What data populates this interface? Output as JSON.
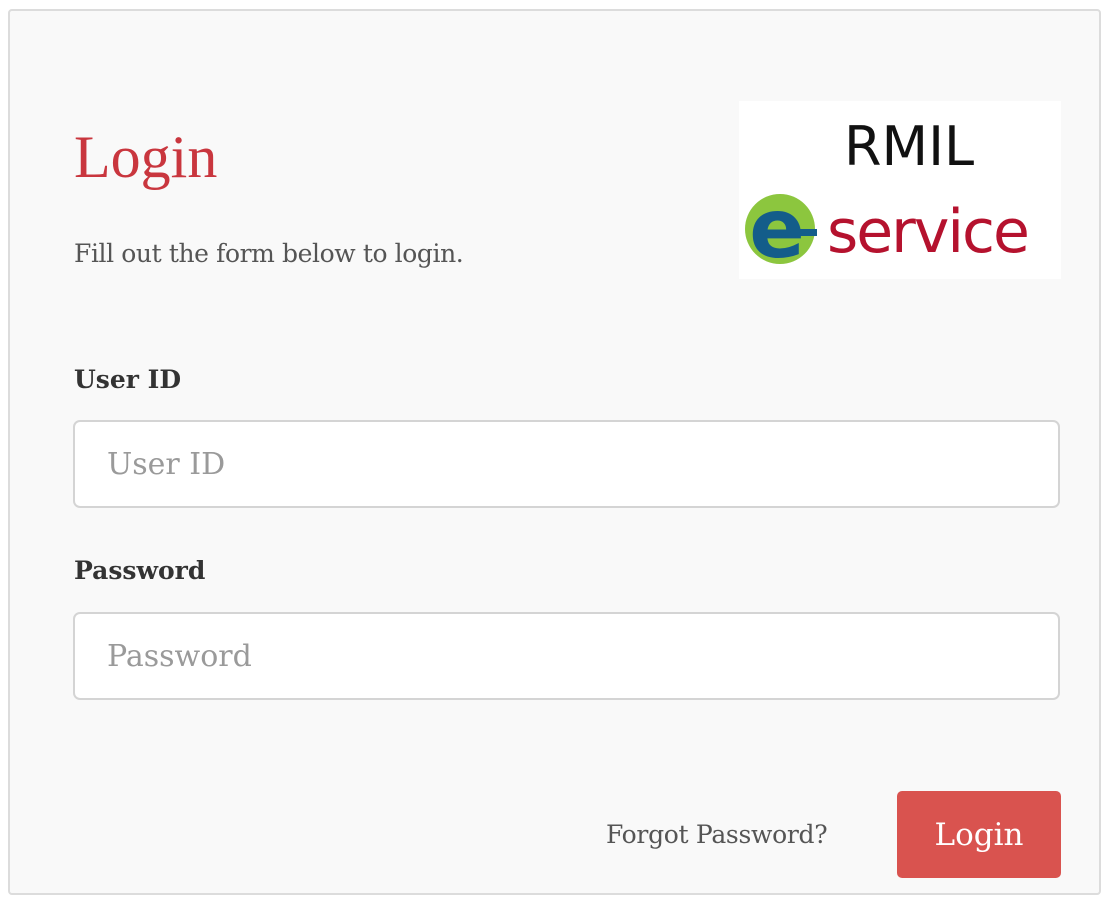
{
  "login_panel": {
    "title": "Login",
    "subtitle": "Fill out the form below to login.",
    "logo": {
      "org": "RMIL",
      "service": "e-service",
      "service_suffix": "service",
      "colors": {
        "badge_green": "#8cc63e",
        "badge_blue": "#135d8a",
        "service_red": "#b5122e"
      }
    },
    "form": {
      "user_id": {
        "label": "User ID",
        "placeholder": "User ID",
        "value": ""
      },
      "password": {
        "label": "Password",
        "placeholder": "Password",
        "value": ""
      }
    },
    "actions": {
      "forgot_password_label": "Forgot Password?",
      "submit_label": "Login"
    }
  },
  "colors": {
    "accent": "#c9363e",
    "button": "#d9534f",
    "panel_bg": "#f9f9f9",
    "border": "#dcdcdc"
  }
}
